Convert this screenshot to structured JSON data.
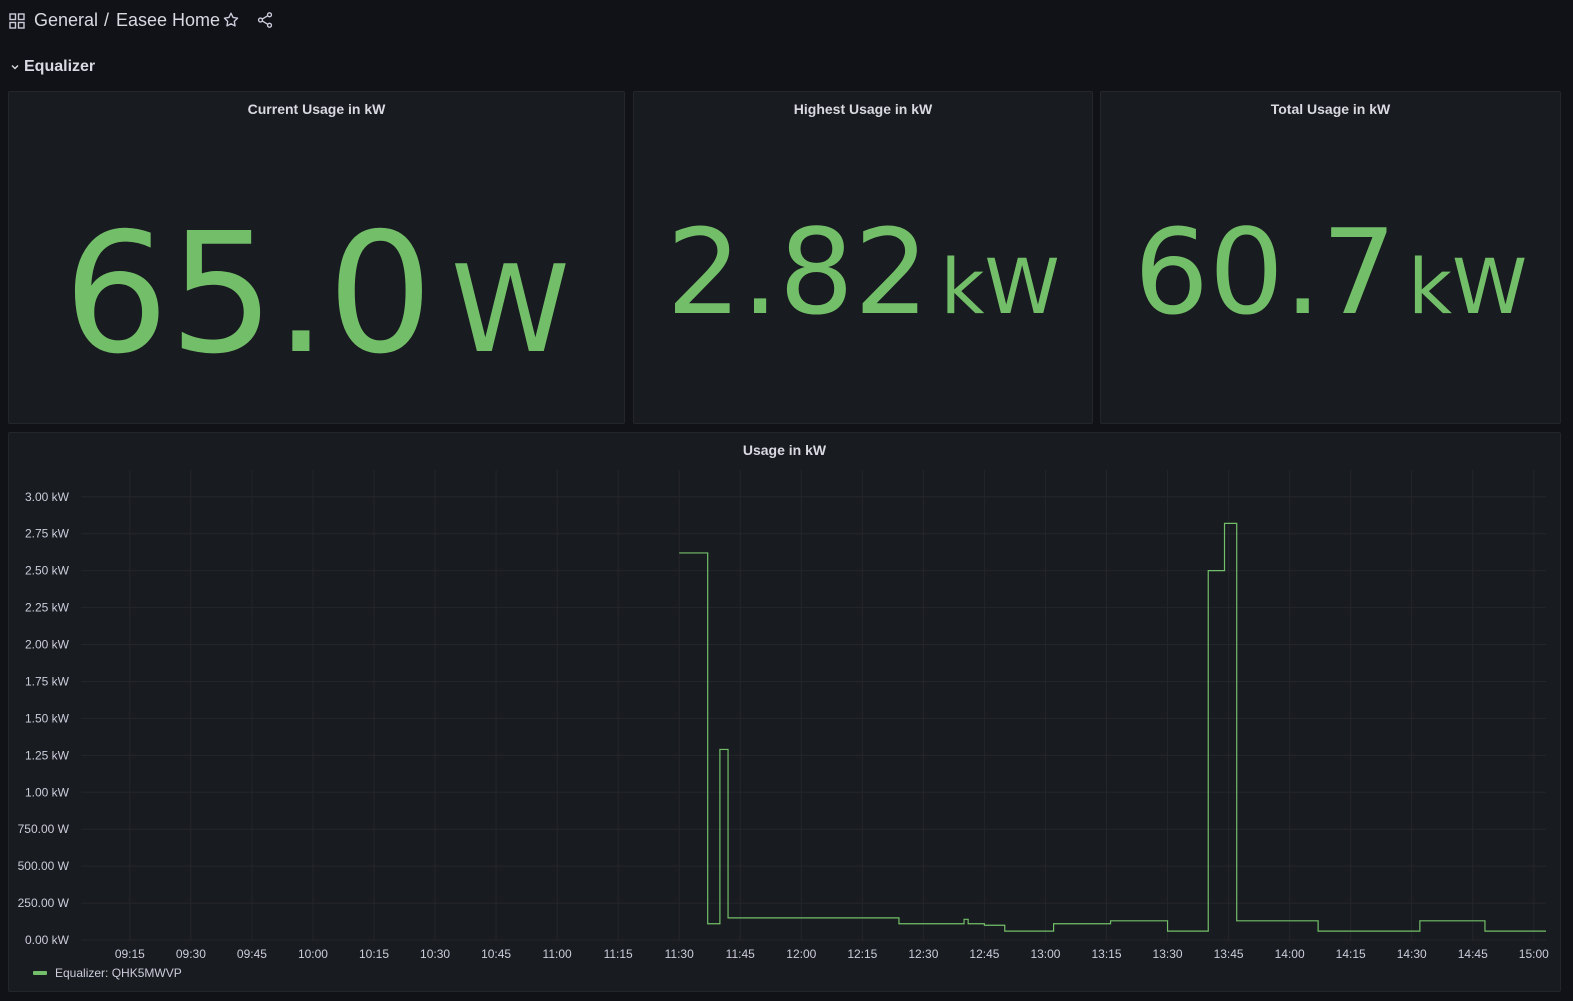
{
  "breadcrumb": {
    "folder": "General",
    "separator": "/",
    "dashboard": "Easee Home"
  },
  "row": {
    "title": "Equalizer"
  },
  "stats": [
    {
      "title": "Current Usage in kW",
      "value": "65.0",
      "unit": "W"
    },
    {
      "title": "Highest Usage in kW",
      "value": "2.82",
      "unit": "kW"
    },
    {
      "title": "Total Usage in kW",
      "value": "60.7",
      "unit": "kW"
    }
  ],
  "colors": {
    "accent": "#73bf69",
    "background": "#111217",
    "panel": "#181b1f"
  },
  "chart_data": {
    "type": "line",
    "title": "Usage in kW",
    "step": true,
    "grid": true,
    "legend_placement": "bottom-left",
    "ylabel": "",
    "xlabel": "",
    "ylim_kw": [
      0,
      3.1
    ],
    "yticks": [
      {
        "v": 0,
        "label": "0.00 kW"
      },
      {
        "v": 0.25,
        "label": "250.00 W"
      },
      {
        "v": 0.5,
        "label": "500.00 W"
      },
      {
        "v": 0.75,
        "label": "750.00 W"
      },
      {
        "v": 1.0,
        "label": "1.00 kW"
      },
      {
        "v": 1.25,
        "label": "1.25 kW"
      },
      {
        "v": 1.5,
        "label": "1.50 kW"
      },
      {
        "v": 1.75,
        "label": "1.75 kW"
      },
      {
        "v": 2.0,
        "label": "2.00 kW"
      },
      {
        "v": 2.25,
        "label": "2.25 kW"
      },
      {
        "v": 2.5,
        "label": "2.50 kW"
      },
      {
        "v": 2.75,
        "label": "2.75 kW"
      },
      {
        "v": 3.0,
        "label": "3.00 kW"
      }
    ],
    "xrange": [
      "09:03",
      "15:03"
    ],
    "xticks": [
      "09:15",
      "09:30",
      "09:45",
      "10:00",
      "10:15",
      "10:30",
      "10:45",
      "11:00",
      "11:15",
      "11:30",
      "11:45",
      "12:00",
      "12:15",
      "12:30",
      "12:45",
      "13:00",
      "13:15",
      "13:30",
      "13:45",
      "14:00",
      "14:15",
      "14:30",
      "14:45",
      "15:00"
    ],
    "series": [
      {
        "name": "Equalizer: QHK5MWVP",
        "points": [
          [
            "11:30",
            2.62
          ],
          [
            "11:37",
            0.11
          ],
          [
            "11:40",
            1.29
          ],
          [
            "11:42",
            0.15
          ],
          [
            "12:24",
            0.11
          ],
          [
            "12:40",
            0.14
          ],
          [
            "12:41",
            0.11
          ],
          [
            "12:45",
            0.1
          ],
          [
            "12:50",
            0.06
          ],
          [
            "13:02",
            0.11
          ],
          [
            "13:16",
            0.13
          ],
          [
            "13:30",
            0.06
          ],
          [
            "13:40",
            2.5
          ],
          [
            "13:44",
            2.82
          ],
          [
            "13:47",
            0.13
          ],
          [
            "14:07",
            0.06
          ],
          [
            "14:32",
            0.13
          ],
          [
            "14:48",
            0.06
          ],
          [
            "15:03",
            0.06
          ]
        ]
      }
    ]
  }
}
